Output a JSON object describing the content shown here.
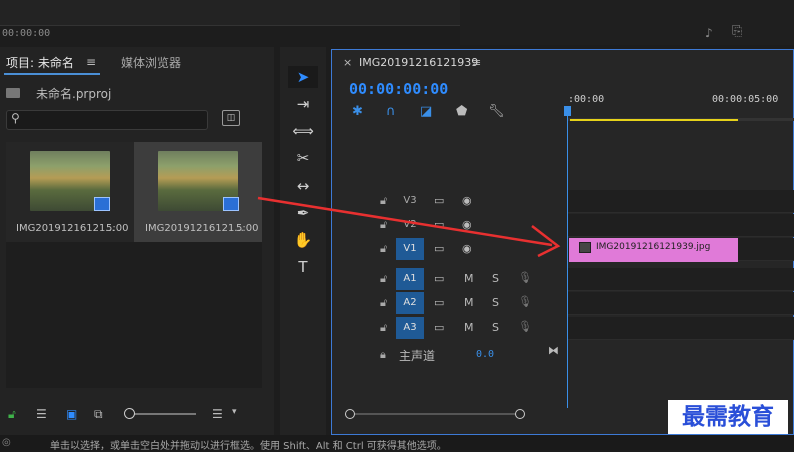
{
  "top": {
    "time_left": "00:00:00",
    "icons": [
      "music-note-icon",
      "export-icon"
    ]
  },
  "project": {
    "tab_active": "项目: 未命名",
    "tab_menu": "≡",
    "tab_media": "媒体浏览器",
    "filename": "未命名.prproj",
    "search_placeholder": "",
    "clips": [
      {
        "name": "IMG20191216121...",
        "duration": "5:00"
      },
      {
        "name": "IMG20191216121...",
        "duration": "5:00"
      }
    ]
  },
  "tools": [
    "selection-tool",
    "track-select-tool",
    "ripple-edit-tool",
    "razor-tool",
    "slip-tool",
    "pen-tool",
    "hand-tool",
    "type-tool"
  ],
  "timeline": {
    "close": "×",
    "sequence_name": "IMG20191216121939",
    "menu": "≡",
    "timecode": "00:00:00:00",
    "ruler": {
      "start": ":00:00",
      "end": "00:00:05:00"
    },
    "tracks": [
      {
        "name": "V3",
        "type": "video",
        "selected": false
      },
      {
        "name": "V2",
        "type": "video",
        "selected": false
      },
      {
        "name": "V1",
        "type": "video",
        "selected": true
      },
      {
        "name": "A1",
        "type": "audio",
        "selected": true,
        "m": "M",
        "s": "S"
      },
      {
        "name": "A2",
        "type": "audio",
        "selected": true,
        "m": "M",
        "s": "S"
      },
      {
        "name": "A3",
        "type": "audio",
        "selected": true,
        "m": "M",
        "s": "S"
      }
    ],
    "clip_label": "IMG20191216121939.jpg",
    "clip_color": "#e07ad8",
    "master_label": "主声道",
    "master_value": "0.0"
  },
  "status": {
    "text": "单击以选择，或单击空白处并拖动以进行框选。使用 Shift、Alt 和 Ctrl 可获得其他选项。"
  },
  "watermark": "最需教育",
  "accent": "#2f8cff",
  "arrow_color": "#e83030"
}
